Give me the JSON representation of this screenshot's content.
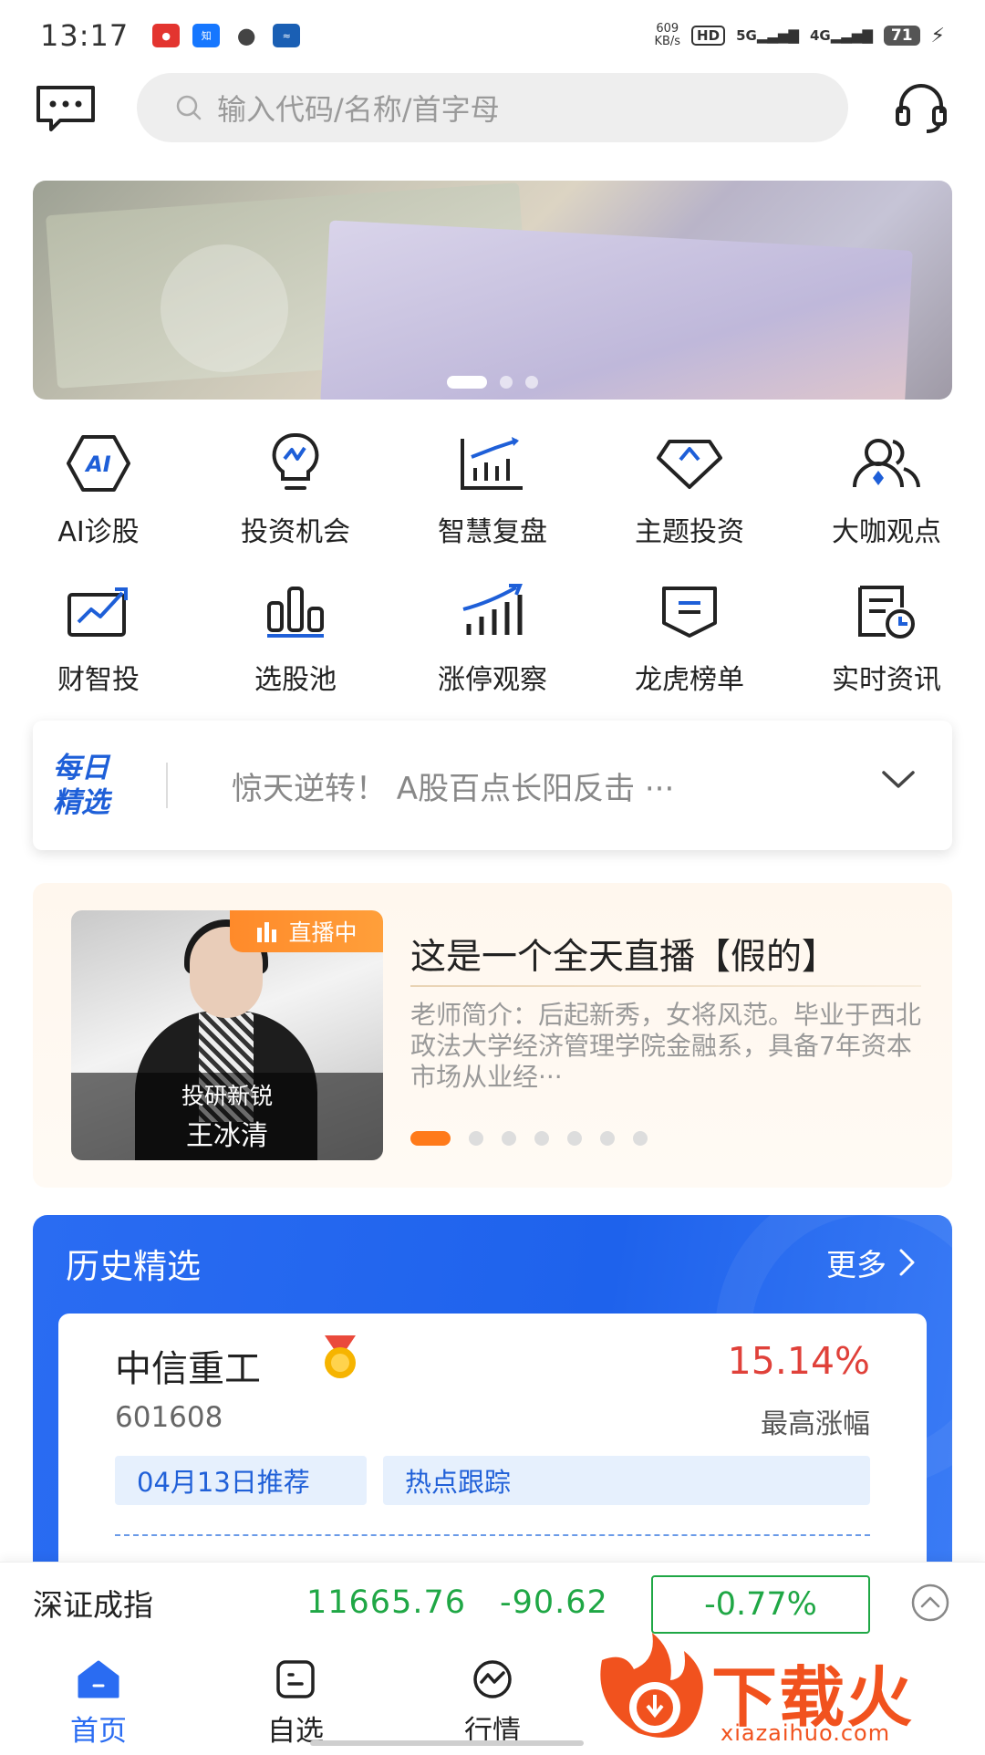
{
  "status_bar": {
    "time": "13:17",
    "speed_value": "609",
    "speed_unit": "KB/s",
    "hd": "HD",
    "net1": "5G",
    "net2": "4G",
    "battery": "71"
  },
  "search": {
    "placeholder": "输入代码/名称/首字母"
  },
  "menu_row1": [
    {
      "label": "AI诊股",
      "icon": "ai-diagnosis-icon"
    },
    {
      "label": "投资机会",
      "icon": "lightbulb-icon"
    },
    {
      "label": "智慧复盘",
      "icon": "bar-chart-icon"
    },
    {
      "label": "主题投资",
      "icon": "diamond-icon"
    },
    {
      "label": "大咖观点",
      "icon": "people-icon"
    }
  ],
  "menu_row2": [
    {
      "label": "财智投",
      "icon": "trend-board-icon"
    },
    {
      "label": "选股池",
      "icon": "columns-icon"
    },
    {
      "label": "涨停观察",
      "icon": "rising-bars-icon"
    },
    {
      "label": "龙虎榜单",
      "icon": "banner-icon"
    },
    {
      "label": "实时资讯",
      "icon": "news-clock-icon"
    }
  ],
  "daily": {
    "logo_line1": "每日",
    "logo_line2": "精选",
    "headline": "惊天逆转！ A股百点长阳反击 ···"
  },
  "live": {
    "badge": "直播中",
    "caption1": "投研新锐",
    "caption2": "王冰清",
    "title": "这是一个全天直播【假的】",
    "description": "老师简介：后起新秀，女将风范。毕业于西北政法大学经济管理学院金融系，具备7年资本市场从业经···"
  },
  "history": {
    "title": "历史精选",
    "more": "更多",
    "stock_name": "中信重工",
    "stock_code": "601608",
    "pct": "15.14%",
    "pct_label": "最高涨幅",
    "tag1": "04月13日推荐",
    "tag2": "热点跟踪"
  },
  "ticker": {
    "name": "深证成指",
    "value": "11665.76",
    "change": "-90.62",
    "pct": "-0.77%"
  },
  "tabs": [
    {
      "label": "首页"
    },
    {
      "label": "自选"
    },
    {
      "label": "行情"
    }
  ],
  "watermark": {
    "text": "下载火",
    "url": "xiazaihuo.com"
  },
  "colors": {
    "accent": "#2a6cf2",
    "down_green": "#1fa745",
    "up_red": "#e0413a",
    "live_orange": "#ff8a2a"
  }
}
